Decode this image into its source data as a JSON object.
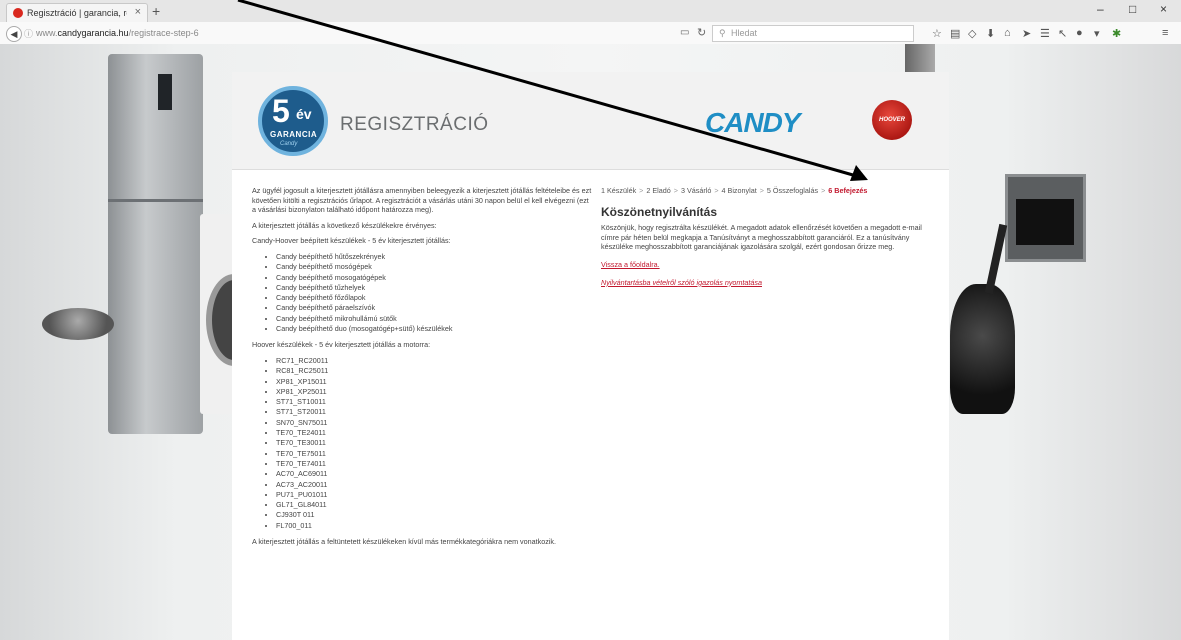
{
  "browser": {
    "tab_title": "Regisztráció | garancia, re...",
    "tab_close": "×",
    "new_tab": "+",
    "url_prefix": "www.",
    "url_domain": "candygarancia.hu",
    "url_path": "/registrace-step-6",
    "search_placeholder": "Hledat",
    "window_controls": [
      "–",
      "□",
      "×"
    ]
  },
  "header": {
    "badge_number": "5",
    "badge_ev": "év",
    "badge_garancia": "GARANCIA",
    "badge_brand": "Candy",
    "title": "REGISZTRÁCIÓ",
    "candy_logo": "CANDY",
    "hoover_logo": "HOOVER"
  },
  "left": {
    "intro": "Az ügyfél jogosult a kiterjesztett jótállásra amennyiben beleegyezik a kiterjesztett jótállás feltételeibe és ezt követően kitölti a regisztrációs űrlapot. A regisztrációt a vásárlás utáni 30 napon belül el kell elvégezni (ezt a vásárlási bizonylaton található időpont határozza meg).",
    "valid_for": "A kiterjesztett jótállás a következő készülékekre érvényes:",
    "candy_heading": "Candy-Hoover beépített készülékek - 5 év kiterjesztett jótállás:",
    "candy_items": [
      "Candy beépíthető hűtőszekrények",
      "Candy beépíthető mosógépek",
      "Candy beépíthető mosogatógépek",
      "Candy beépíthető tűzhelyek",
      "Candy beépíthető főzőlapok",
      "Candy beépíthető páraelszívók",
      "Candy beépíthető mikrohullámú sütők",
      "Candy beépíthető duo (mosogatógép+sütő) készülékek"
    ],
    "hoover_heading": "Hoover készülékek - 5 év kiterjesztett jótállás a motorra:",
    "hoover_items": [
      "RC71_RC20011",
      "RC81_RC25011",
      "XP81_XP15011",
      "XP81_XP25011",
      "ST71_ST10011",
      "ST71_ST20011",
      "SN70_SN75011",
      "TE70_TE24011",
      "TE70_TE30011",
      "TE70_TE75011",
      "TE70_TE74011",
      "AC70_AC69011",
      "AC73_AC20011",
      "PU71_PU01011",
      "GL71_GL84011",
      "CJ930T 011",
      "FL700_011"
    ],
    "footer": "A kiterjesztett jótállás a feltüntetett készülékeken kívül más termékkategóriákra nem vonatkozik."
  },
  "right": {
    "steps": [
      "1 Készülék",
      "2 Eladó",
      "3 Vásárló",
      "4 Bizonylat",
      "5 Összefoglalás",
      "6 Befejezés"
    ],
    "step_separator": ">",
    "title": "Köszönetnyilvánítás",
    "body": "Köszönjük, hogy regisztrálta készülékét. A megadott adatok ellenőrzését követően a megadott e-mail címre pár héten belül megkapja a Tanúsítványt a meghosszabbított garanciáról. Ez a tanúsítvány készüléke meghosszabbított garanciájának igazolására szolgál, ezért gondosan őrizze meg.",
    "link_home": "Vissza a főoldalra.",
    "link_print": "Nyilvántartásba vételről szóló igazolás nyomtatása"
  },
  "colors": {
    "accent_red": "#c2182e",
    "candy_blue": "#1f8ec5",
    "badge_blue": "#1e5c8c"
  }
}
